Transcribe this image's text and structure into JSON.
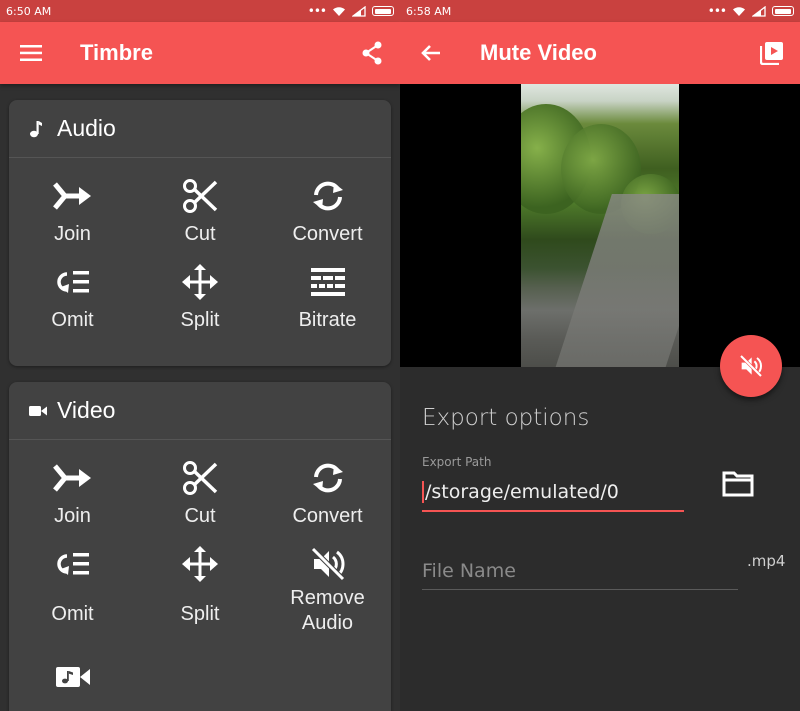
{
  "left": {
    "status": {
      "time": "6:50 AM"
    },
    "appbar": {
      "title": "Timbre"
    },
    "audio": {
      "header": "Audio",
      "tools": [
        {
          "label": "Join",
          "icon": "merge-icon"
        },
        {
          "label": "Cut",
          "icon": "scissors-icon"
        },
        {
          "label": "Convert",
          "icon": "convert-icon"
        },
        {
          "label": "Omit",
          "icon": "omit-icon"
        },
        {
          "label": "Split",
          "icon": "split-icon"
        },
        {
          "label": "Bitrate",
          "icon": "bitrate-icon"
        }
      ]
    },
    "video": {
      "header": "Video",
      "tools": [
        {
          "label": "Join",
          "icon": "merge-icon"
        },
        {
          "label": "Cut",
          "icon": "scissors-icon"
        },
        {
          "label": "Convert",
          "icon": "convert-icon"
        },
        {
          "label": "Omit",
          "icon": "omit-icon"
        },
        {
          "label": "Split",
          "icon": "split-icon"
        },
        {
          "label": "Remove\nAudio",
          "icon": "mute-icon"
        }
      ]
    }
  },
  "right": {
    "status": {
      "time": "6:58 AM"
    },
    "appbar": {
      "title": "Mute Video"
    },
    "export": {
      "title": "Export options",
      "path_label": "Export Path",
      "path_value": "/storage/emulated/0",
      "filename_placeholder": "File Name",
      "extension": ".mp4"
    }
  },
  "colors": {
    "accent": "#f55453",
    "statusbar": "#c9413f",
    "card": "#424242",
    "background": "#303030"
  }
}
